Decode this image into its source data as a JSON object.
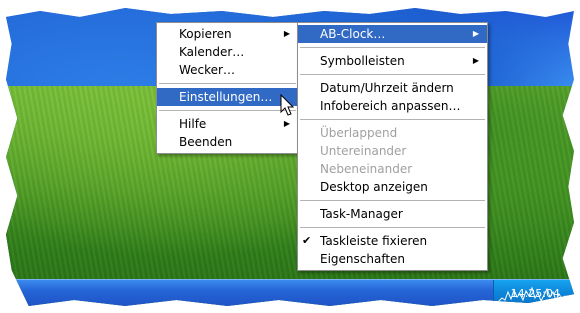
{
  "left_menu": {
    "items": [
      {
        "label": "Kopieren",
        "submenu": true
      },
      {
        "label": "Kalender…"
      },
      {
        "label": "Wecker…"
      },
      {
        "label": "Einstellungen…",
        "highlighted": true
      },
      {
        "label": "Hilfe",
        "submenu": true
      },
      {
        "label": "Beenden"
      }
    ]
  },
  "right_menu": {
    "items": [
      {
        "label": "AB-Clock…",
        "submenu": true,
        "highlighted": true
      },
      {
        "label": "Symbolleisten",
        "submenu": true
      },
      {
        "label": "Datum/Uhrzeit ändern"
      },
      {
        "label": "Infobereich anpassen…"
      },
      {
        "label": "Überlappend",
        "disabled": true
      },
      {
        "label": "Untereinander",
        "disabled": true
      },
      {
        "label": "Nebeneinander",
        "disabled": true
      },
      {
        "label": "Desktop anzeigen"
      },
      {
        "label": "Task-Manager"
      },
      {
        "label": "Taskleiste fixieren",
        "checked": true
      },
      {
        "label": "Eigenschaften"
      }
    ]
  },
  "tray": {
    "clock": "14:25:04"
  },
  "colors": {
    "highlight": "#316ac5",
    "taskbar": "#2565d6",
    "tray": "#0d84d8"
  },
  "icons": {
    "submenu": "triangle-right",
    "check": "checkmark",
    "cursor": "arrow-pointer"
  }
}
